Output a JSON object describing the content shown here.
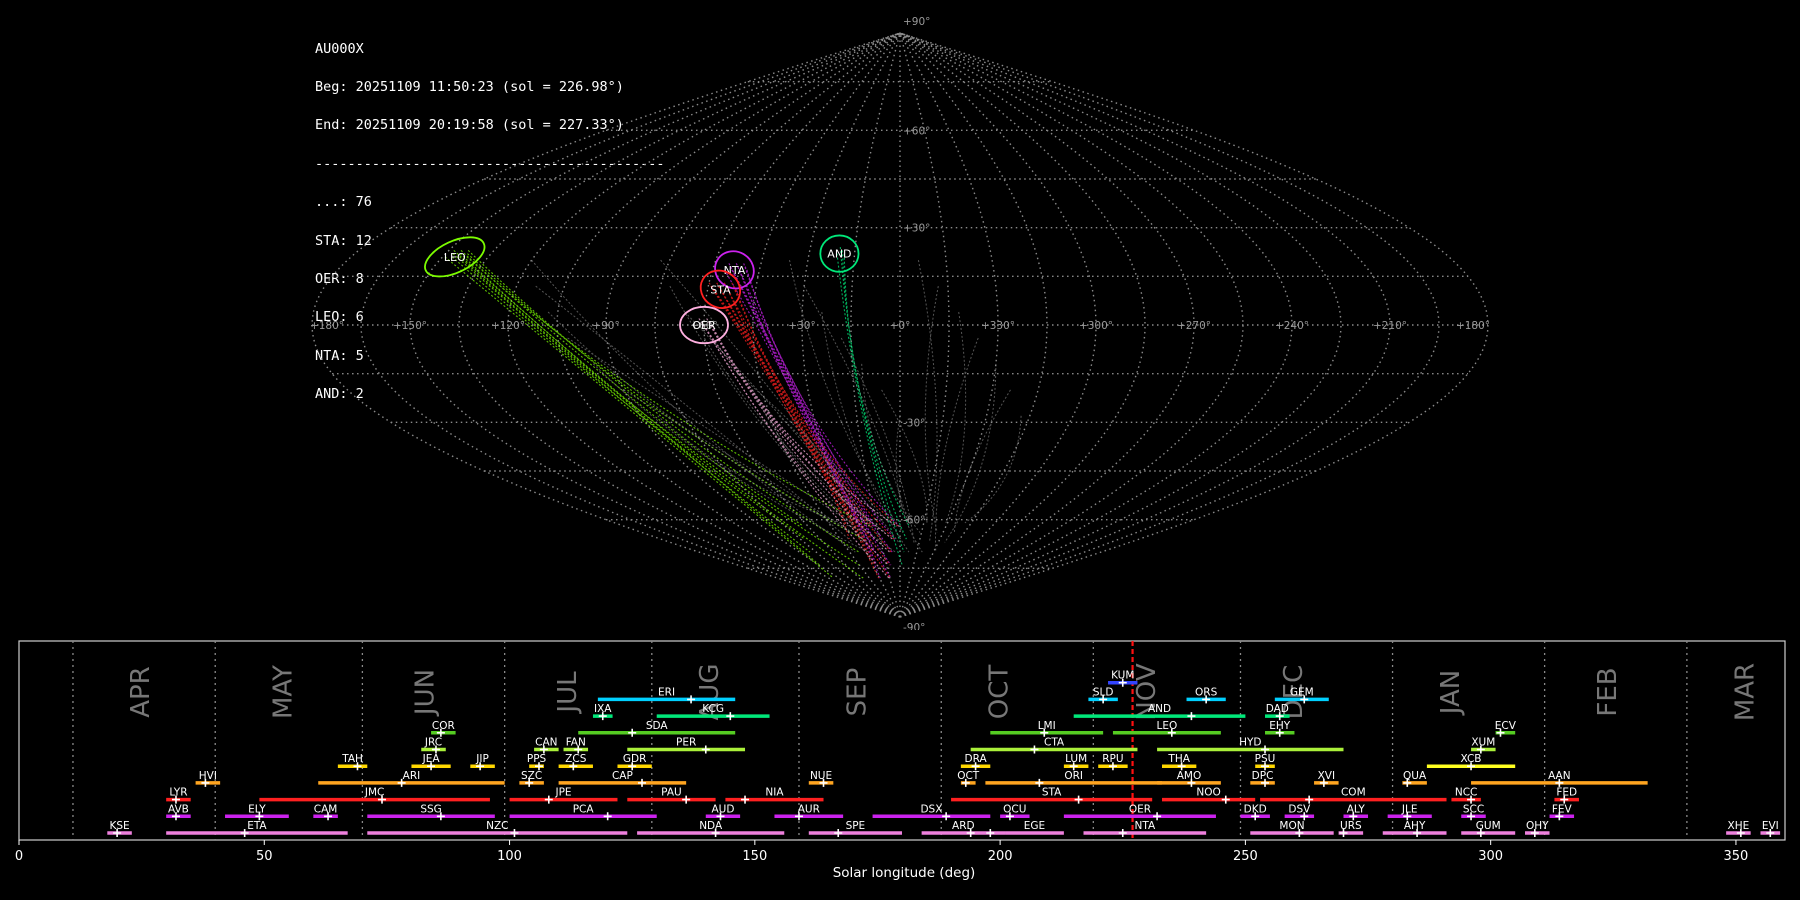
{
  "summary": {
    "station": "AU000X",
    "begin": "Beg: 20251109 11:50:23 (sol = 226.98°)",
    "end": "End: 20251109 20:19:58 (sol = 227.33°)",
    "separator": "-------------------------------------------",
    "counts": [
      {
        "label": "...: 76"
      },
      {
        "label": "STA: 12"
      },
      {
        "label": "OER: 8"
      },
      {
        "label": "LEO: 6"
      },
      {
        "label": "NTA: 5"
      },
      {
        "label": "AND: 2"
      }
    ]
  },
  "chart_data": [
    {
      "type": "scatter",
      "projection": "sinusoidal",
      "lon_labels": [
        {
          "text": "+180°",
          "lon": 180
        },
        {
          "text": "+150°",
          "lon": 150
        },
        {
          "text": "+120°",
          "lon": 120
        },
        {
          "text": "+90°",
          "lon": 90
        },
        {
          "text": "+60°",
          "lon": 60
        },
        {
          "text": "+30°",
          "lon": 30
        },
        {
          "text": "+0°",
          "lon": 0
        },
        {
          "text": "+330°",
          "lon": -30
        },
        {
          "text": "+300°",
          "lon": -60
        },
        {
          "text": "+270°",
          "lon": -90
        },
        {
          "text": "+240°",
          "lon": -120
        },
        {
          "text": "+210°",
          "lon": -150
        },
        {
          "text": "+180°",
          "lon": -180
        }
      ],
      "lat_labels": [
        {
          "text": "+90°",
          "lat": 90
        },
        {
          "text": "+60°",
          "lat": 60
        },
        {
          "text": "+30°",
          "lat": 30
        },
        {
          "text": "-30°",
          "lat": -30
        },
        {
          "text": "-60°",
          "lat": -60
        },
        {
          "text": "-90°",
          "lat": -90
        }
      ],
      "radiants": [
        {
          "name": "LEO",
          "lon": 146,
          "lat": 21,
          "rx": 10,
          "ry": 6,
          "rot": -25,
          "color": "#7cfc00"
        },
        {
          "name": "NTA",
          "lon": 53,
          "lat": 17,
          "rx": 6,
          "ry": 7,
          "rot": 30,
          "color": "#cc22ee"
        },
        {
          "name": "STA",
          "lon": 56,
          "lat": 11,
          "rx": 6,
          "ry": 7,
          "rot": 30,
          "color": "#ff2020"
        },
        {
          "name": "AND",
          "lon": 20,
          "lat": 22,
          "rx": 6,
          "ry": 7,
          "rot": 0,
          "color": "#00e87a"
        },
        {
          "name": "OER",
          "lon": 60,
          "lat": 0,
          "rx": 7,
          "ry": 7,
          "rot": 0,
          "color": "#ffb0e0"
        }
      ]
    },
    {
      "type": "bar",
      "xlabel": "Solar longitude (deg)",
      "xlim": [
        0,
        360
      ],
      "xticks": [
        0,
        50,
        100,
        150,
        200,
        250,
        300,
        350
      ],
      "current_sol": 227.0,
      "months": [
        {
          "name": "APR",
          "sol": 25
        },
        {
          "name": "MAY",
          "sol": 54
        },
        {
          "name": "JUN",
          "sol": 83
        },
        {
          "name": "JUL",
          "sol": 112
        },
        {
          "name": "AUG",
          "sol": 141
        },
        {
          "name": "SEP",
          "sol": 171
        },
        {
          "name": "OCT",
          "sol": 200
        },
        {
          "name": "NOV",
          "sol": 230
        },
        {
          "name": "DEC",
          "sol": 260
        },
        {
          "name": "JAN",
          "sol": 292
        },
        {
          "name": "FEB",
          "sol": 324
        },
        {
          "name": "MAR",
          "sol": 352
        }
      ],
      "month_dividers": [
        11,
        40,
        70,
        99,
        129,
        159,
        188,
        219,
        249,
        280,
        311,
        340
      ],
      "showers": [
        {
          "code": "KUM",
          "start": 222,
          "end": 228,
          "peak": 225,
          "row": 10,
          "color": "#3344ff"
        },
        {
          "code": "ERI",
          "start": 118,
          "end": 146,
          "peak": 137,
          "row": 9,
          "color": "#00d0ff"
        },
        {
          "code": "SLD",
          "start": 218,
          "end": 224,
          "peak": 221,
          "row": 9,
          "color": "#00d0ff"
        },
        {
          "code": "ORS",
          "start": 238,
          "end": 246,
          "peak": 242,
          "row": 9,
          "color": "#00d0ff"
        },
        {
          "code": "GEM",
          "start": 256,
          "end": 267,
          "peak": 262,
          "row": 9,
          "color": "#00d0ff"
        },
        {
          "code": "IXA",
          "start": 117,
          "end": 121,
          "peak": 119,
          "row": 8,
          "color": "#00e87a"
        },
        {
          "code": "KCG",
          "start": 130,
          "end": 153,
          "peak": 145,
          "row": 8,
          "color": "#00e87a"
        },
        {
          "code": "AND",
          "start": 215,
          "end": 250,
          "peak": 239,
          "row": 8,
          "color": "#00e87a"
        },
        {
          "code": "DAD",
          "start": 254,
          "end": 259,
          "peak": 257,
          "row": 8,
          "color": "#00e87a"
        },
        {
          "code": "COR",
          "start": 84,
          "end": 89,
          "peak": 86,
          "row": 7,
          "color": "#55cc22"
        },
        {
          "code": "SDA",
          "start": 114,
          "end": 146,
          "peak": 125,
          "row": 7,
          "color": "#55cc22"
        },
        {
          "code": "LMI",
          "start": 198,
          "end": 221,
          "peak": 209,
          "row": 7,
          "color": "#55cc22"
        },
        {
          "code": "LEO",
          "start": 223,
          "end": 245,
          "peak": 235,
          "row": 7,
          "color": "#55cc22"
        },
        {
          "code": "EHY",
          "start": 254,
          "end": 260,
          "peak": 257,
          "row": 7,
          "color": "#55cc22"
        },
        {
          "code": "ECV",
          "start": 301,
          "end": 305,
          "peak": 302,
          "row": 7,
          "color": "#55cc22"
        },
        {
          "code": "JRC",
          "start": 82,
          "end": 87,
          "peak": 85,
          "row": 6,
          "color": "#aaf03a"
        },
        {
          "code": "CAN",
          "start": 105,
          "end": 110,
          "peak": 107,
          "row": 6,
          "color": "#aaf03a"
        },
        {
          "code": "FAN",
          "start": 111,
          "end": 116,
          "peak": 114,
          "row": 6,
          "color": "#aaf03a"
        },
        {
          "code": "PER",
          "start": 124,
          "end": 148,
          "peak": 140,
          "row": 6,
          "color": "#aaf03a"
        },
        {
          "code": "CTA",
          "start": 194,
          "end": 228,
          "peak": 207,
          "row": 6,
          "color": "#aaf03a"
        },
        {
          "code": "HYD",
          "start": 232,
          "end": 270,
          "peak": 254,
          "row": 6,
          "color": "#aaf03a"
        },
        {
          "code": "XUM",
          "start": 296,
          "end": 301,
          "peak": 298,
          "row": 6,
          "color": "#aaf03a"
        },
        {
          "code": "TAH",
          "start": 65,
          "end": 71,
          "peak": 69,
          "row": 5,
          "color": "#ffd700"
        },
        {
          "code": "JEA",
          "start": 80,
          "end": 88,
          "peak": 84,
          "row": 5,
          "color": "#ffd700"
        },
        {
          "code": "JIP",
          "start": 92,
          "end": 97,
          "peak": 94,
          "row": 5,
          "color": "#ffd700"
        },
        {
          "code": "PPS",
          "start": 104,
          "end": 107,
          "peak": 106,
          "row": 5,
          "color": "#ffd700"
        },
        {
          "code": "ZCS",
          "start": 110,
          "end": 117,
          "peak": 113,
          "row": 5,
          "color": "#ffd700"
        },
        {
          "code": "GDR",
          "start": 122,
          "end": 129,
          "peak": 125,
          "row": 5,
          "color": "#ffd700"
        },
        {
          "code": "DRA",
          "start": 192,
          "end": 198,
          "peak": 195,
          "row": 5,
          "color": "#ffd700"
        },
        {
          "code": "LUM",
          "start": 213,
          "end": 218,
          "peak": 215,
          "row": 5,
          "color": "#ffd700"
        },
        {
          "code": "RPU",
          "start": 220,
          "end": 226,
          "peak": 223,
          "row": 5,
          "color": "#ffd700"
        },
        {
          "code": "THA",
          "start": 233,
          "end": 240,
          "peak": 237,
          "row": 5,
          "color": "#ffd700"
        },
        {
          "code": "PSU",
          "start": 252,
          "end": 256,
          "peak": 254,
          "row": 5,
          "color": "#ffd700"
        },
        {
          "code": "XCB",
          "start": 287,
          "end": 305,
          "peak": 296,
          "row": 5,
          "color": "#ffff20"
        },
        {
          "code": "HVI",
          "start": 36,
          "end": 41,
          "peak": 38,
          "row": 4,
          "color": "#ffa520"
        },
        {
          "code": "ARI",
          "start": 61,
          "end": 99,
          "peak": 78,
          "row": 4,
          "color": "#ffa520"
        },
        {
          "code": "SZC",
          "start": 102,
          "end": 107,
          "peak": 104,
          "row": 4,
          "color": "#ffa520"
        },
        {
          "code": "CAP",
          "start": 110,
          "end": 136,
          "peak": 127,
          "row": 4,
          "color": "#ffa520"
        },
        {
          "code": "NUE",
          "start": 161,
          "end": 166,
          "peak": 164,
          "row": 4,
          "color": "#ffa520"
        },
        {
          "code": "OCT",
          "start": 192,
          "end": 195,
          "peak": 193,
          "row": 4,
          "color": "#ffa520"
        },
        {
          "code": "ORI",
          "start": 197,
          "end": 233,
          "peak": 208,
          "row": 4,
          "color": "#ffa520"
        },
        {
          "code": "AMO",
          "start": 232,
          "end": 245,
          "peak": 239,
          "row": 4,
          "color": "#ffa520"
        },
        {
          "code": "DPC",
          "start": 251,
          "end": 256,
          "peak": 254,
          "row": 4,
          "color": "#ffa520"
        },
        {
          "code": "XVI",
          "start": 264,
          "end": 269,
          "peak": 266,
          "row": 4,
          "color": "#ffa520"
        },
        {
          "code": "QUA",
          "start": 282,
          "end": 287,
          "peak": 283,
          "row": 4,
          "color": "#ffa520"
        },
        {
          "code": "AAN",
          "start": 296,
          "end": 332,
          "peak": 314,
          "row": 4,
          "color": "#ffa520"
        },
        {
          "code": "LYR",
          "start": 30,
          "end": 35,
          "peak": 32,
          "row": 3,
          "color": "#ff2020"
        },
        {
          "code": "JMC",
          "start": 49,
          "end": 96,
          "peak": 74,
          "row": 3,
          "color": "#ff2020"
        },
        {
          "code": "JPE",
          "start": 100,
          "end": 122,
          "peak": 108,
          "row": 3,
          "color": "#ff2020"
        },
        {
          "code": "PAU",
          "start": 124,
          "end": 142,
          "peak": 136,
          "row": 3,
          "color": "#ff2020"
        },
        {
          "code": "NIA",
          "start": 144,
          "end": 164,
          "peak": 148,
          "row": 3,
          "color": "#ff2020"
        },
        {
          "code": "STA",
          "start": 190,
          "end": 231,
          "peak": 216,
          "row": 3,
          "color": "#ff2020"
        },
        {
          "code": "NOO",
          "start": 233,
          "end": 252,
          "peak": 246,
          "row": 3,
          "color": "#ff2020"
        },
        {
          "code": "COM",
          "start": 253,
          "end": 291,
          "peak": 263,
          "row": 3,
          "color": "#ff2020"
        },
        {
          "code": "NCC",
          "start": 292,
          "end": 298,
          "peak": 296,
          "row": 3,
          "color": "#ff2020"
        },
        {
          "code": "FED",
          "start": 313,
          "end": 318,
          "peak": 315,
          "row": 3,
          "color": "#ff2020"
        },
        {
          "code": "AVB",
          "start": 30,
          "end": 35,
          "peak": 32,
          "row": 2,
          "color": "#cc22ee"
        },
        {
          "code": "ELY",
          "start": 42,
          "end": 55,
          "peak": 49,
          "row": 2,
          "color": "#cc22ee"
        },
        {
          "code": "CAM",
          "start": 60,
          "end": 65,
          "peak": 63,
          "row": 2,
          "color": "#cc22ee"
        },
        {
          "code": "SSG",
          "start": 71,
          "end": 97,
          "peak": 86,
          "row": 2,
          "color": "#cc22ee"
        },
        {
          "code": "PCA",
          "start": 100,
          "end": 130,
          "peak": 120,
          "row": 2,
          "color": "#cc22ee"
        },
        {
          "code": "AUD",
          "start": 140,
          "end": 147,
          "peak": 143,
          "row": 2,
          "color": "#cc22ee"
        },
        {
          "code": "AUR",
          "start": 154,
          "end": 168,
          "peak": 159,
          "row": 2,
          "color": "#cc22ee"
        },
        {
          "code": "DSX",
          "start": 174,
          "end": 198,
          "peak": 189,
          "row": 2,
          "color": "#cc22ee"
        },
        {
          "code": "OCU",
          "start": 200,
          "end": 206,
          "peak": 202,
          "row": 2,
          "color": "#cc22ee"
        },
        {
          "code": "OER",
          "start": 213,
          "end": 244,
          "peak": 232,
          "row": 2,
          "color": "#cc22ee"
        },
        {
          "code": "DKD",
          "start": 249,
          "end": 255,
          "peak": 252,
          "row": 2,
          "color": "#cc22ee"
        },
        {
          "code": "DSV",
          "start": 258,
          "end": 264,
          "peak": 262,
          "row": 2,
          "color": "#cc22ee"
        },
        {
          "code": "ALY",
          "start": 270,
          "end": 275,
          "peak": 272,
          "row": 2,
          "color": "#cc22ee"
        },
        {
          "code": "JLE",
          "start": 279,
          "end": 288,
          "peak": 283,
          "row": 2,
          "color": "#cc22ee"
        },
        {
          "code": "SCC",
          "start": 294,
          "end": 299,
          "peak": 296,
          "row": 2,
          "color": "#cc22ee"
        },
        {
          "code": "FEV",
          "start": 312,
          "end": 317,
          "peak": 314,
          "row": 2,
          "color": "#cc22ee"
        },
        {
          "code": "KSE",
          "start": 18,
          "end": 23,
          "peak": 20,
          "row": 1,
          "color": "#ee80dd"
        },
        {
          "code": "ETA",
          "start": 30,
          "end": 67,
          "peak": 46,
          "row": 1,
          "color": "#ee80dd"
        },
        {
          "code": "NZC",
          "start": 71,
          "end": 124,
          "peak": 101,
          "row": 1,
          "color": "#ee80dd"
        },
        {
          "code": "NDA",
          "start": 126,
          "end": 156,
          "peak": 142,
          "row": 1,
          "color": "#ee80dd"
        },
        {
          "code": "SPE",
          "start": 161,
          "end": 180,
          "peak": 167,
          "row": 1,
          "color": "#ee80dd"
        },
        {
          "code": "ARD",
          "start": 184,
          "end": 201,
          "peak": 194,
          "row": 1,
          "color": "#ee80dd"
        },
        {
          "code": "EGE",
          "start": 201,
          "end": 213,
          "peak": 198,
          "row": 1,
          "color": "#ee80dd"
        },
        {
          "code": "NTA",
          "start": 217,
          "end": 242,
          "peak": 225,
          "row": 1,
          "color": "#ee80dd"
        },
        {
          "code": "MON",
          "start": 251,
          "end": 268,
          "peak": 261,
          "row": 1,
          "color": "#ee80dd"
        },
        {
          "code": "URS",
          "start": 269,
          "end": 274,
          "peak": 270,
          "row": 1,
          "color": "#ee80dd"
        },
        {
          "code": "AHY",
          "start": 278,
          "end": 291,
          "peak": 285,
          "row": 1,
          "color": "#ee80dd"
        },
        {
          "code": "GUM",
          "start": 294,
          "end": 305,
          "peak": 298,
          "row": 1,
          "color": "#ee80dd"
        },
        {
          "code": "OHY",
          "start": 307,
          "end": 312,
          "peak": 309,
          "row": 1,
          "color": "#ee80dd"
        },
        {
          "code": "XHE",
          "start": 348,
          "end": 353,
          "peak": 351,
          "row": 1,
          "color": "#ee80dd"
        },
        {
          "code": "EVI",
          "start": 355,
          "end": 359,
          "peak": 357,
          "row": 1,
          "color": "#ee80dd"
        }
      ]
    }
  ]
}
